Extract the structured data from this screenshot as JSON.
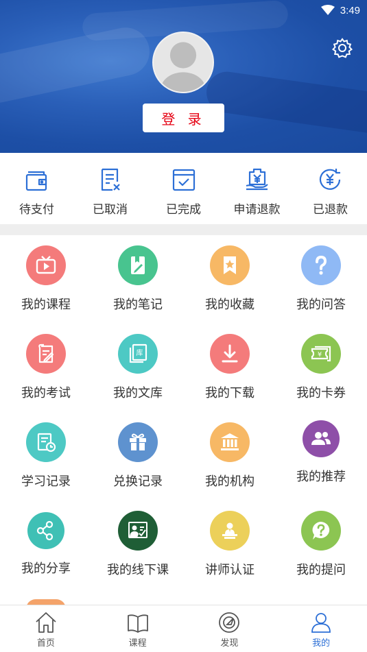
{
  "status_bar": {
    "time": "3:49"
  },
  "header": {
    "login_label": "登 录"
  },
  "orders": [
    {
      "label": "待支付",
      "icon": "wallet-icon"
    },
    {
      "label": "已取消",
      "icon": "cancelled-order-icon"
    },
    {
      "label": "已完成",
      "icon": "completed-order-icon"
    },
    {
      "label": "申请退款",
      "icon": "refund-request-icon"
    },
    {
      "label": "已退款",
      "icon": "refunded-icon"
    }
  ],
  "grid": [
    {
      "label": "我的课程",
      "icon": "tv-icon",
      "color": "#f47b7b"
    },
    {
      "label": "我的笔记",
      "icon": "notebook-icon",
      "color": "#48c48f"
    },
    {
      "label": "我的收藏",
      "icon": "bookmark-star-icon",
      "color": "#f7b865"
    },
    {
      "label": "我的问答",
      "icon": "question-icon",
      "color": "#8fb9f5"
    },
    {
      "label": "我的考试",
      "icon": "exam-icon",
      "color": "#f47b7b"
    },
    {
      "label": "我的文库",
      "icon": "library-icon",
      "color": "#4dc9c4"
    },
    {
      "label": "我的下载",
      "icon": "download-icon",
      "color": "#f47b7b"
    },
    {
      "label": "我的卡券",
      "icon": "coupon-icon",
      "color": "#8cc552"
    },
    {
      "label": "学习记录",
      "icon": "study-record-icon",
      "color": "#4dc9c4"
    },
    {
      "label": "兑换记录",
      "icon": "gift-icon",
      "color": "#5e92cf"
    },
    {
      "label": "我的机构",
      "icon": "institution-icon",
      "color": "#f7b865"
    },
    {
      "label": "我的推荐",
      "icon": "people-icon",
      "color": "#8e4fa8"
    },
    {
      "label": "我的分享",
      "icon": "share-icon",
      "color": "#3fc0b5"
    },
    {
      "label": "我的线下课",
      "icon": "offline-class-icon",
      "color": "#1f5e36"
    },
    {
      "label": "讲师认证",
      "icon": "lecturer-icon",
      "color": "#ecd05a"
    },
    {
      "label": "我的提问",
      "icon": "ask-icon",
      "color": "#8cc552"
    }
  ],
  "tabs": [
    {
      "label": "首页",
      "icon": "home-icon",
      "active": false
    },
    {
      "label": "课程",
      "icon": "book-icon",
      "active": false
    },
    {
      "label": "发现",
      "icon": "discover-icon",
      "active": false
    },
    {
      "label": "我的",
      "icon": "user-icon",
      "active": true
    }
  ],
  "colors": {
    "accent": "#2c6fd6",
    "login_text": "#e60012",
    "order_icon": "#2c6fd6"
  }
}
